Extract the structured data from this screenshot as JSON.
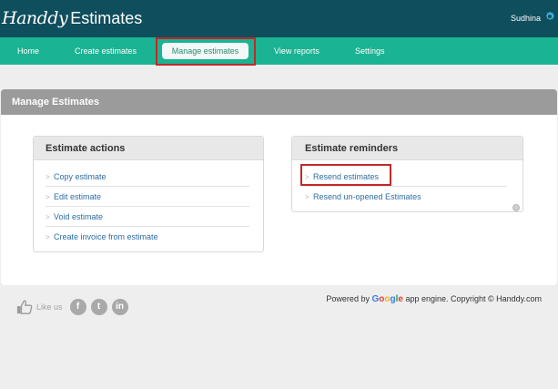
{
  "app": {
    "logo_script": "Handdy",
    "logo_word": "Estimates"
  },
  "header": {
    "username": "Sudhina"
  },
  "nav": {
    "home": "Home",
    "create": "Create estimates",
    "manage": "Manage estimates",
    "reports": "View reports",
    "settings": "Settings"
  },
  "page": {
    "title": "Manage Estimates"
  },
  "estimate_actions": {
    "title": "Estimate actions",
    "items": [
      "Copy estimate",
      "Edit estimate",
      "Void estimate",
      "Create invoice from estimate"
    ]
  },
  "estimate_reminders": {
    "title": "Estimate reminders",
    "items": [
      "Resend estimates",
      "Resend un-opened Estimates"
    ]
  },
  "footer": {
    "like_text": "Like us",
    "social": {
      "facebook": "f",
      "twitter": "t",
      "linkedin": "in"
    },
    "powered_prefix": "Powered by",
    "google_word": "Google",
    "powered_suffix": "app engine. Copyright © Handdy.com"
  },
  "colors": {
    "topbar": "#0f4e5d",
    "navbar": "#1ab393",
    "highlight_border": "#c2282a",
    "link": "#2e6da4"
  }
}
